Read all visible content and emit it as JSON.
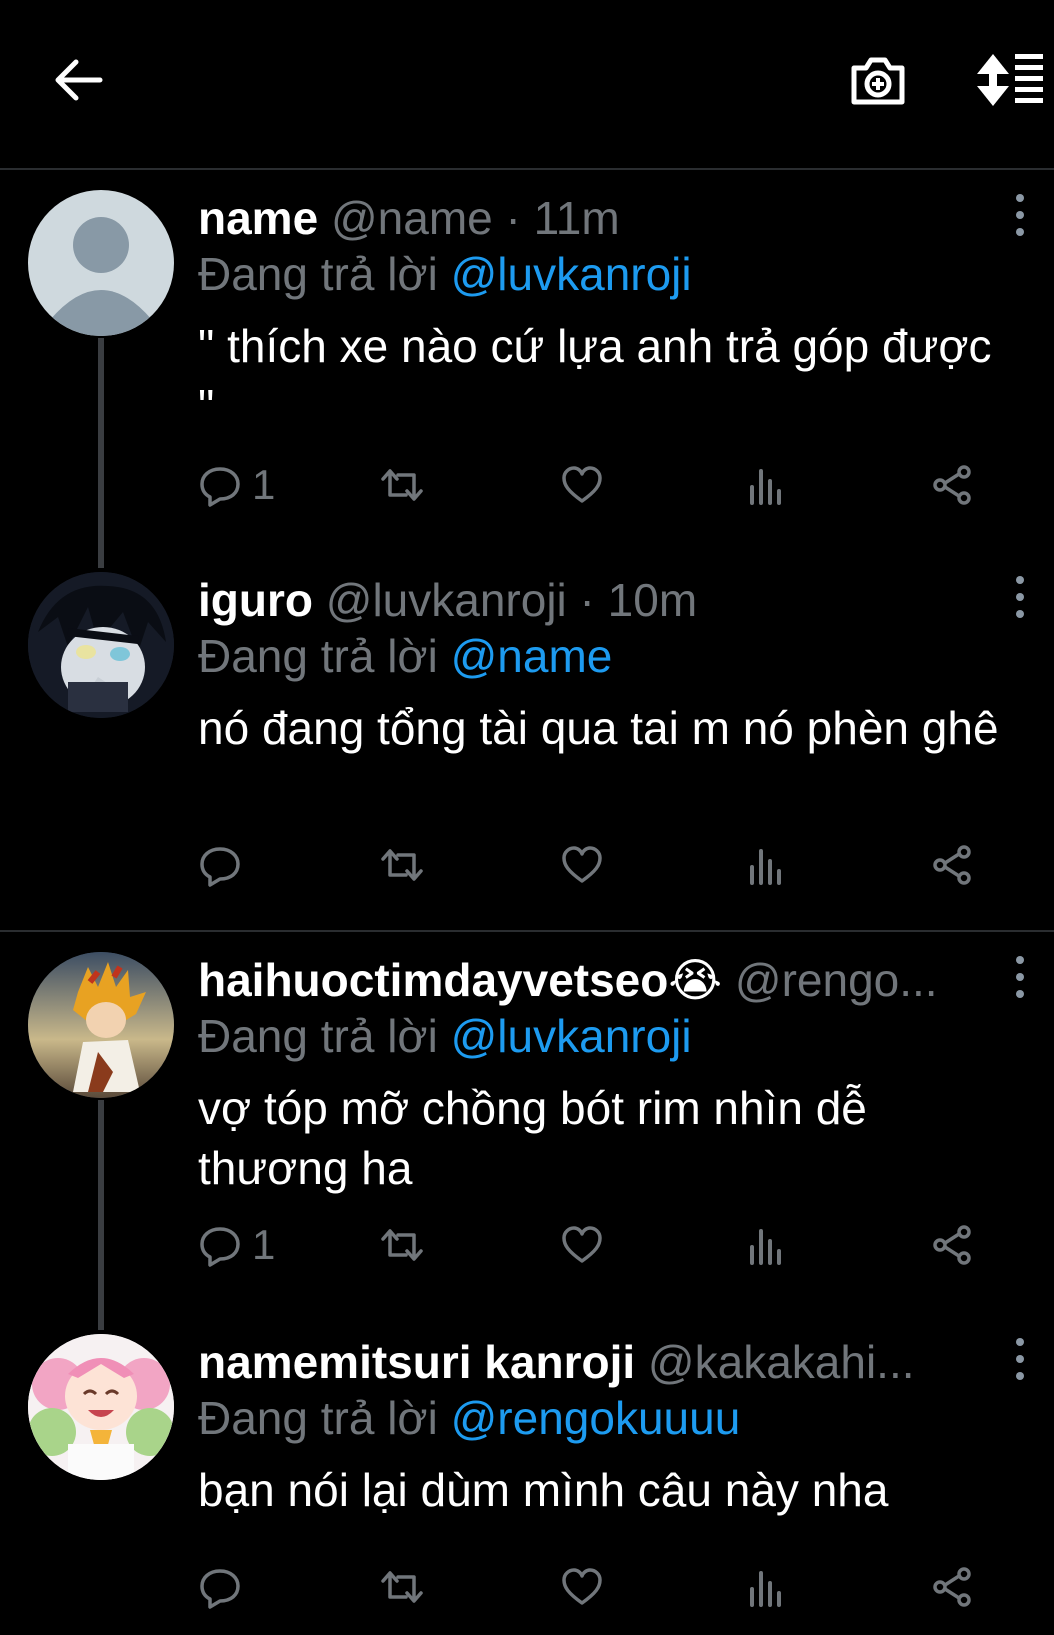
{
  "colors": {
    "background": "#000000",
    "muted": "#71767b",
    "link": "#1d9bf0",
    "text": "#ffffff"
  },
  "topbar": {
    "back_icon": "arrow-left-icon",
    "camera_icon": "camera-add-icon",
    "sort_icon": "sort-icon"
  },
  "tweets": [
    {
      "name": "name",
      "handle": "@name · 11m",
      "reply_prefix": "Đang trả lời",
      "reply_to": "@luvkanroji",
      "text": "\" thích xe nào cứ lựa anh trả góp được \"",
      "reply_count": "1"
    },
    {
      "name": "iguro",
      "handle": "@luvkanroji · 10m",
      "reply_prefix": "Đang trả lời",
      "reply_to": "@name",
      "text": "nó đang tổng tài qua tai m nó phèn ghê",
      "reply_count": ""
    },
    {
      "name": "haihuoctimdayvetseo😭",
      "handle": "@rengo...",
      "reply_prefix": "Đang trả lời",
      "reply_to": "@luvkanroji",
      "text": "vợ tóp mỡ chồng bót rim nhìn dễ thương ha",
      "reply_count": "1"
    },
    {
      "name": "namemitsuri kanroji",
      "handle": "@kakakahi...",
      "reply_prefix": "Đang trả lời",
      "reply_to": "@rengokuuuu",
      "text": "bạn nói lại dùm mình câu này nha",
      "reply_count": ""
    }
  ]
}
